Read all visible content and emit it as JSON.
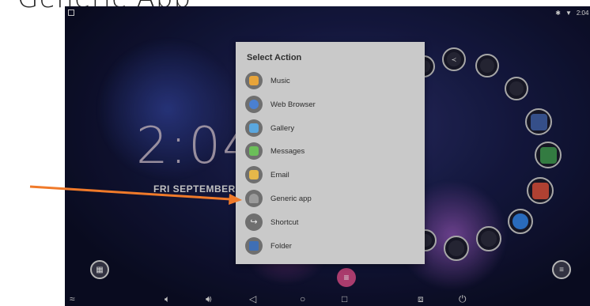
{
  "page_caption": "Generic App",
  "status": {
    "time": "2:04 P"
  },
  "home": {
    "clock": "2:04",
    "date": "FRI SEPTEMBER"
  },
  "dialog": {
    "title": "Select Action",
    "actions": [
      {
        "label": "Music",
        "icon": "music-icon",
        "color": "#e7a43a"
      },
      {
        "label": "Web Browser",
        "icon": "globe-icon",
        "color": "#4a80d2"
      },
      {
        "label": "Gallery",
        "icon": "gallery-icon",
        "color": "#5aa7df"
      },
      {
        "label": "Messages",
        "icon": "messages-icon",
        "color": "#6bbf59"
      },
      {
        "label": "Email",
        "icon": "email-icon",
        "color": "#e6b84a"
      },
      {
        "label": "Generic app",
        "icon": "android-icon",
        "color": "#8a8a8a"
      },
      {
        "label": "Shortcut",
        "icon": "shortcut-icon",
        "color": "#7c7c7c"
      },
      {
        "label": "Folder",
        "icon": "folder-icon",
        "color": "#3f6fb5"
      }
    ]
  },
  "annotation": {
    "arrow_color": "#f07a2a"
  },
  "colors": {
    "dialog_bg": "#c9c9c9",
    "fab": "#c2457d",
    "screen_bg": "#161a44"
  }
}
